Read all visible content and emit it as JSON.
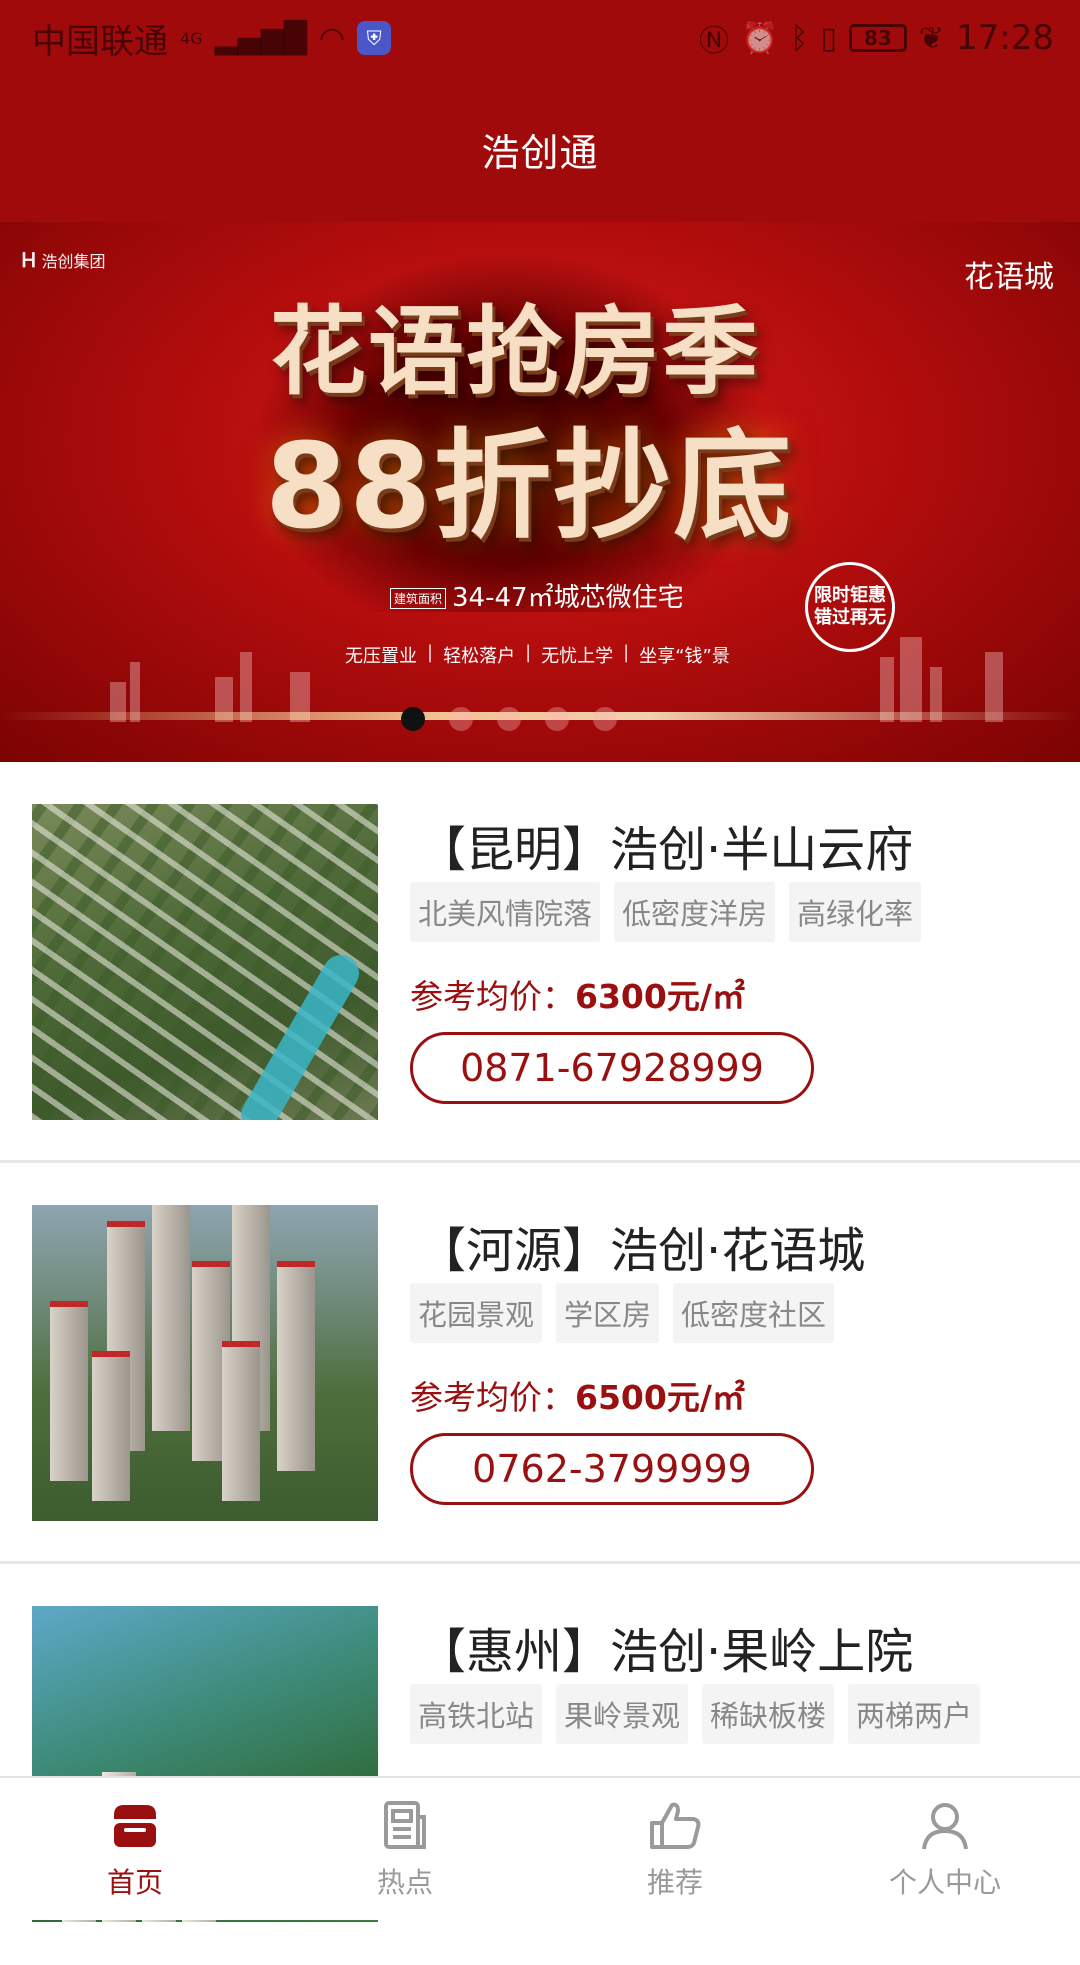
{
  "status_bar": {
    "carrier": "中国联通",
    "network": "4G",
    "battery": "83",
    "time": "17:28"
  },
  "header": {
    "title": "浩创通"
  },
  "banner": {
    "brand_left": "浩创集团",
    "brand_right": "花语城",
    "headline_line1": "花语抢房季",
    "headline_line2": "88折抄底",
    "sub_tag": "建筑面积",
    "subtitle": "34-47㎡城芯微住宅",
    "stamp_line1": "限时钜惠",
    "stamp_line2": "错过再无",
    "features": [
      "无压置业",
      "轻松落户",
      "无忧上学",
      "坐享“钱”景"
    ],
    "active_dot": 1,
    "dot_count": 5
  },
  "listings": [
    {
      "name": "【昆明】浩创·半山云府",
      "tags": [
        "北美风情院落",
        "低密度洋房",
        "高绿化率"
      ],
      "price_label": "参考均价：",
      "price_value": "6300元/㎡",
      "phone": "0871-67928999"
    },
    {
      "name": "【河源】浩创·花语城",
      "tags": [
        "花园景观",
        "学区房",
        "低密度社区"
      ],
      "price_label": "参考均价：",
      "price_value": "6500元/㎡",
      "phone": "0762-3799999"
    },
    {
      "name": "【惠州】浩创·果岭上院",
      "tags": [
        "高铁北站",
        "果岭景观",
        "稀缺板楼",
        "两梯两户"
      ],
      "price_label": "",
      "price_value": "",
      "phone": ""
    }
  ],
  "bottom_nav": [
    {
      "label": "首页",
      "icon": "home-icon",
      "active": true
    },
    {
      "label": "热点",
      "icon": "news-icon",
      "active": false
    },
    {
      "label": "推荐",
      "icon": "thumbs-up-icon",
      "active": false
    },
    {
      "label": "个人中心",
      "icon": "user-icon",
      "active": false
    }
  ],
  "colors": {
    "primary": "#a10a0a",
    "accent_text": "#9a0f0f",
    "tag_bg": "#f4f4f4",
    "inactive_nav": "#9a9a9a"
  }
}
